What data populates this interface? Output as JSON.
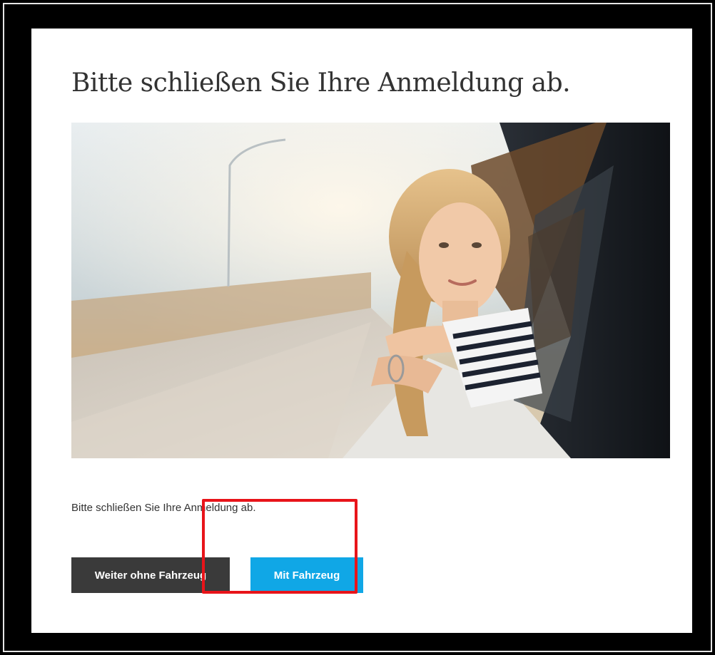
{
  "page": {
    "heading": "Bitte schließen Sie Ihre Anmeldung ab.",
    "body_text": "Bitte schließen Sie Ihre Anmeldung ab.",
    "hero_image": "woman-leaning-out-of-car-window-photo"
  },
  "actions": {
    "secondary_label": "Weiter ohne Fahrzeug",
    "primary_label": "Mit Fahrzeug"
  },
  "annotation": {
    "highlight_color": "#e8141a",
    "highlight_target": "Mit Fahrzeug"
  },
  "colors": {
    "secondary_button": "#3a3a3a",
    "primary_button": "#10a7e6",
    "text": "#333333"
  }
}
